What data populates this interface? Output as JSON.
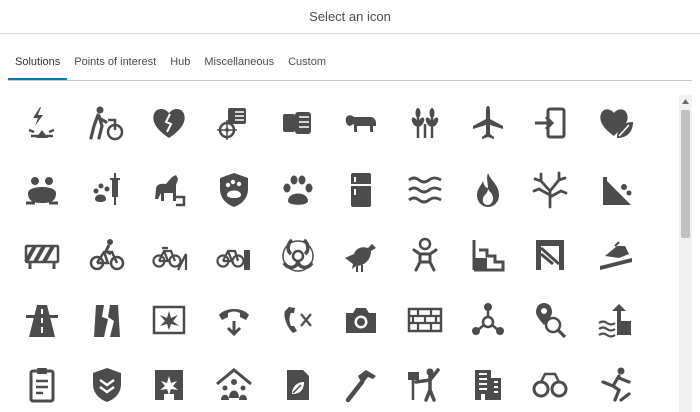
{
  "dialog": {
    "title": "Select an icon"
  },
  "tabs": [
    {
      "label": "Solutions",
      "active": true
    },
    {
      "label": "Points of interest",
      "active": false
    },
    {
      "label": "Hub",
      "active": false
    },
    {
      "label": "Miscellaneous",
      "active": false
    },
    {
      "label": "Custom",
      "active": false
    }
  ],
  "colors": {
    "icon": "#4c4c4c",
    "accent": "#007ac2"
  },
  "icons": [
    [
      "lightning-strike-icon",
      "wheelchair-assist-icon",
      "broken-heart-icon",
      "target-fist-icon",
      "fist-icon",
      "cow-icon",
      "wheat-icon",
      "airplane-icon",
      "sign-in-icon",
      "heart-leaf-icon"
    ],
    [
      "frog-icon",
      "paw-syringe-icon",
      "horse-icon",
      "paw-shield-icon",
      "paw-print-icon",
      "refrigerator-icon",
      "water-waves-icon",
      "fire-icon",
      "coral-icon",
      "landslide-icon"
    ],
    [
      "road-barrier-icon",
      "bicycle-rider-icon",
      "bicycle-ramp-icon",
      "bicycle-wall-icon",
      "biohazard-icon",
      "bird-icon",
      "baby-icon",
      "stairs-icon",
      "gate-icon",
      "boat-ramp-icon"
    ],
    [
      "highway-icon",
      "broken-road-icon",
      "damaged-frame-icon",
      "phone-down-icon",
      "phone-x-icon",
      "camera-icon",
      "brick-wall-icon",
      "network-hub-icon",
      "location-search-icon",
      "flood-arrow-icon"
    ],
    [
      "clipboard-list-icon",
      "shield-badge-icon",
      "building-damage-icon",
      "community-house-icon",
      "leaf-document-icon",
      "hammer-icon",
      "person-sign-icon",
      "office-building-icon",
      "handcuffs-icon",
      "falling-person-icon"
    ]
  ]
}
